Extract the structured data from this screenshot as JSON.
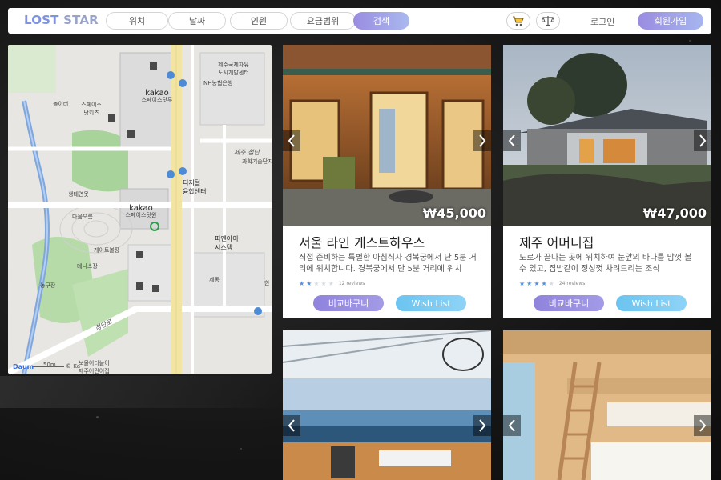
{
  "brand": {
    "logo_part1": "LOST",
    "logo_part2": "STAR"
  },
  "nav": {
    "location": "위치",
    "date": "날짜",
    "guests": "인원",
    "price_range": "요금범위",
    "search": "검색",
    "cart_icon": "cart-icon",
    "compare_icon": "scale-icon",
    "login": "로그인",
    "signup": "회원가입"
  },
  "map": {
    "labels": {
      "playground": "놀이터",
      "space_dot_kids": "스페이스\n닷키즈",
      "kakao1_name": "kakao",
      "kakao1_sub": "스페이스닷투",
      "jeju_center": "제주국제자유\n도시개발센터",
      "nh_bank": "NH농협은행",
      "jeju_univ": "제주 첨단",
      "science_road": "과학기술단지",
      "digital_center": "디지털\n융합센터",
      "creative": "생태연못",
      "dream": "다음오름",
      "kakao2_name": "kakao",
      "kakao2_sub": "스페이스닷원",
      "game_space": "게이트볼장",
      "tennis": "테니스장",
      "piano": "피엔아이\n시스템",
      "jedong": "제동",
      "basketball": "농구장",
      "kids_cafe": "보물이터놀이\n제주어린이집",
      "han": "한",
      "scale": "50m",
      "copyright": "© Ka",
      "road_1": "첨단로",
      "daum_logo": "Daum"
    }
  },
  "listings": [
    {
      "title": "서울 라인 게스트하우스",
      "desc": "직접 준비하는 특별한 아침식사 경복궁에서 단 5분 거리에 위치합니다. 경복궁에서 단 5분 거리에 위치",
      "price": "₩45,000",
      "rating": 2,
      "reviews": "12 reviews",
      "compare_label": "비교바구니",
      "wish_label": "Wish List"
    },
    {
      "title": "제주 어머니집",
      "desc": "도로가 끝나는 곳에 위치하여 눈앞의 바다를 맘껏 볼 수 있고, 집밥같이 정성껏 차려드리는 조식",
      "price": "₩47,000",
      "rating": 4,
      "reviews": "24 reviews",
      "compare_label": "비교바구니",
      "wish_label": "Wish List"
    },
    {
      "title": "",
      "price": ""
    },
    {
      "title": "",
      "price": ""
    }
  ],
  "colors": {
    "accent_purple": "#9a8ce0",
    "accent_blue": "#6bc4f0",
    "star_blue": "#4f8fe0",
    "star_empty": "#d6dbe6"
  }
}
